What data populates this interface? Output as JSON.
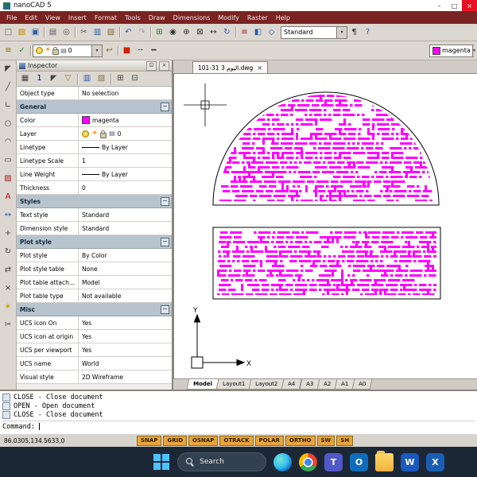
{
  "ui": {
    "arrow": "▾",
    "minimize": "–",
    "maximize": "□",
    "close": "×",
    "pin": "⊡",
    "panel_close": "×",
    "section_collapse": "−",
    "sun_glyph": "☀",
    "plot_glyph": "▤"
  },
  "window": {
    "title": "nanoCAD 5"
  },
  "menu": {
    "items": [
      "File",
      "Edit",
      "View",
      "Insert",
      "Format",
      "Tools",
      "Draw",
      "Dimensions",
      "Modify",
      "Raster",
      "Help"
    ]
  },
  "toolbar1": {
    "standard_value": "Standard",
    "icons": [
      {
        "name": "new-document-icon",
        "glyph": "□",
        "color": "#5a5a5a"
      },
      {
        "name": "open-icon",
        "glyph": "▨",
        "color": "#c08a00"
      },
      {
        "name": "save-icon",
        "glyph": "▣",
        "color": "#2a5caa"
      },
      {
        "sep": true
      },
      {
        "name": "print-icon",
        "glyph": "▤",
        "color": "#5a5a5a"
      },
      {
        "name": "print-preview-icon",
        "glyph": "◎",
        "color": "#5a5a5a"
      },
      {
        "sep": true
      },
      {
        "name": "cut-icon",
        "glyph": "✂",
        "color": "#555555"
      },
      {
        "name": "copy-icon",
        "glyph": "▥",
        "color": "#2a5caa"
      },
      {
        "name": "paste-icon",
        "glyph": "▧",
        "color": "#8a6d3b"
      },
      {
        "sep": true
      },
      {
        "name": "undo-icon",
        "glyph": "↶",
        "color": "#2a5caa"
      },
      {
        "name": "redo-icon",
        "glyph": "↷",
        "color": "#9a9a9a"
      },
      {
        "sep": true
      },
      {
        "name": "properties-icon",
        "glyph": "⊞",
        "color": "#2a7a2a"
      },
      {
        "name": "find-icon",
        "glyph": "◉",
        "color": "#333333"
      },
      {
        "name": "zoom-in-icon",
        "glyph": "⊕",
        "color": "#333333"
      },
      {
        "name": "zoom-extents-icon",
        "glyph": "⊠",
        "color": "#333333"
      },
      {
        "name": "pan-icon",
        "glyph": "↔",
        "color": "#333333"
      },
      {
        "name": "regen-icon",
        "glyph": "↻",
        "color": "#2a5caa"
      },
      {
        "sep": true
      },
      {
        "name": "layers-dialog-icon",
        "glyph": "≡",
        "color": "#aa2222"
      },
      {
        "name": "draw-order-icon",
        "glyph": "◧",
        "color": "#2a5caa"
      },
      {
        "name": "osnap-settings-icon",
        "glyph": "◇",
        "color": "#2a5caa"
      }
    ],
    "after_icons": [
      {
        "name": "text-styles-icon",
        "glyph": "¶",
        "color": "#333333"
      },
      {
        "name": "help-icon",
        "glyph": "?",
        "color": "#2a5caa"
      }
    ]
  },
  "toolbar2": {
    "layer_name": "0",
    "color_name": "magenta",
    "color_value": "#ff00ff",
    "left_icons": [
      {
        "name": "layer-properties-icon",
        "glyph": "≡",
        "color": "#8a6d00"
      },
      {
        "name": "make-current-layer-icon",
        "glyph": "✓",
        "color": "#2a7a2a"
      },
      {
        "sep": true
      }
    ],
    "mid_icons": [
      {
        "name": "layer-previous-icon",
        "glyph": "↩",
        "color": "#8a6d00"
      },
      {
        "sep": true
      },
      {
        "name": "color-control-icon",
        "glyph": "■",
        "color": "#cc2200"
      },
      {
        "name": "linetype-control-icon",
        "glyph": "╌",
        "color": "#333333"
      },
      {
        "name": "lineweight-control-icon",
        "glyph": "━",
        "color": "#333333"
      }
    ]
  },
  "left_toolbar": {
    "icons": [
      {
        "name": "select-icon",
        "glyph": "◤",
        "color": "#444444"
      },
      {
        "name": "line-icon",
        "glyph": "╱",
        "color": "#444444"
      },
      {
        "name": "polyline-icon",
        "glyph": "∟",
        "color": "#444444"
      },
      {
        "name": "circle-icon",
        "glyph": "○",
        "color": "#444444"
      },
      {
        "name": "arc-icon",
        "glyph": "◠",
        "color": "#444444"
      },
      {
        "name": "rectangle-icon",
        "glyph": "▭",
        "color": "#444444"
      },
      {
        "name": "hatch-icon",
        "glyph": "▨",
        "color": "#aa2222"
      },
      {
        "name": "text-icon",
        "glyph": "A",
        "color": "#bb0000"
      },
      {
        "name": "dimension-icon",
        "glyph": "↔",
        "color": "#2a5caa"
      },
      {
        "name": "move-icon",
        "glyph": "+",
        "color": "#444444"
      },
      {
        "name": "rotate-icon",
        "glyph": "↻",
        "color": "#444444"
      },
      {
        "name": "mirror-icon",
        "glyph": "⇄",
        "color": "#444444"
      },
      {
        "name": "erase-icon",
        "glyph": "×",
        "color": "#444444"
      },
      {
        "name": "explode-icon",
        "glyph": "∗",
        "color": "#c9a000"
      },
      {
        "name": "trim-icon",
        "glyph": "✂",
        "color": "#444444"
      }
    ]
  },
  "inspector": {
    "title": "Inspector",
    "toolbar_icons": [
      {
        "name": "grid-view-icon",
        "glyph": "▦",
        "color": "#444444"
      },
      {
        "name": "selection-count-icon",
        "glyph": "1",
        "color": "#0000aa"
      },
      {
        "name": "select-objects-icon",
        "glyph": "◤",
        "color": "#444444"
      },
      {
        "name": "quick-filter-icon",
        "glyph": "▽",
        "color": "#aa6600"
      },
      {
        "sep": true
      },
      {
        "name": "copy-properties-icon",
        "glyph": "▥",
        "color": "#2a5caa"
      },
      {
        "name": "paste-properties-icon",
        "glyph": "▧",
        "color": "#8a6d3b"
      },
      {
        "sep": true
      },
      {
        "name": "expand-all-icon",
        "glyph": "⊞",
        "color": "#444444"
      },
      {
        "name": "collapse-all-icon",
        "glyph": "⊟",
        "color": "#444444"
      }
    ],
    "rows": [
      {
        "type": "prop",
        "label": "Object type",
        "value": "No selection"
      },
      {
        "type": "section",
        "label": "General"
      },
      {
        "type": "color",
        "label": "Color",
        "value": "magenta",
        "swatch": "#ff00ff"
      },
      {
        "type": "layer",
        "label": "Layer",
        "value": "0"
      },
      {
        "type": "linetype",
        "label": "Linetype",
        "value": "By Layer"
      },
      {
        "type": "prop",
        "label": "Linetype Scale",
        "value": "1"
      },
      {
        "type": "linetype",
        "label": "Line Weight",
        "value": "By Layer"
      },
      {
        "type": "prop",
        "label": "Thickness",
        "value": "0"
      },
      {
        "type": "section",
        "label": "Styles"
      },
      {
        "type": "prop",
        "label": "Text style",
        "value": "Standard"
      },
      {
        "type": "prop",
        "label": "Dimension style",
        "value": "Standard"
      },
      {
        "type": "section",
        "label": "Plot style"
      },
      {
        "type": "prop",
        "label": "Plot style",
        "value": "By Color"
      },
      {
        "type": "prop",
        "label": "Plot style table",
        "value": "None"
      },
      {
        "type": "prop",
        "label": "Plot table attach...",
        "value": "Model"
      },
      {
        "type": "prop",
        "label": "Plot table type",
        "value": "Not available"
      },
      {
        "type": "section",
        "label": "Misc"
      },
      {
        "type": "prop",
        "label": "UCS icon On",
        "value": "Yes"
      },
      {
        "type": "prop",
        "label": "UCS icon at origin",
        "value": "Yes"
      },
      {
        "type": "prop",
        "label": "UCS per viewport",
        "value": "Yes"
      },
      {
        "type": "prop",
        "label": "UCS name",
        "value": "World"
      },
      {
        "type": "prop",
        "label": "Visual style",
        "value": "2D Wireframe"
      }
    ]
  },
  "document": {
    "tab": "101-31 3 اليوم.dwg",
    "tab_close": "×",
    "layout_tabs": [
      "Model",
      "Layout1",
      "Layout2",
      "A4",
      "A3",
      "A2",
      "A1",
      "A0"
    ],
    "active_layout": "Model"
  },
  "canvas": {
    "pattern_color": "#ff00ff",
    "outline_color": "#000000",
    "ucs_x": "X",
    "ucs_y": "Y"
  },
  "command": {
    "lines": [
      "CLOSE - Close document",
      "OPEN - Open document",
      "CLOSE - Close document"
    ],
    "prompt": "Command:"
  },
  "status": {
    "coords": "86.0305,134.5633,0",
    "toggles": [
      "SNAP",
      "GRID",
      "OSNAP",
      "OTRACK",
      "POLAR",
      "ORTHO",
      "SW",
      "SH"
    ]
  },
  "taskbar": {
    "search_placeholder": "Search",
    "icons": [
      {
        "name": "edge-icon",
        "kind": "edge"
      },
      {
        "name": "chrome-icon",
        "kind": "chrome"
      },
      {
        "name": "teams-icon",
        "kind": "plain",
        "color": "#5059c9",
        "label": "T"
      },
      {
        "name": "outlook-icon",
        "kind": "plain",
        "color": "#0f6cbd",
        "label": "O"
      },
      {
        "name": "file-explorer-icon",
        "kind": "folder"
      },
      {
        "name": "word-icon",
        "kind": "plain",
        "color": "#185abd",
        "label": "W"
      },
      {
        "name": "excel-icon",
        "kind": "plain",
        "color": "#1a5db4",
        "label": "X"
      }
    ]
  }
}
